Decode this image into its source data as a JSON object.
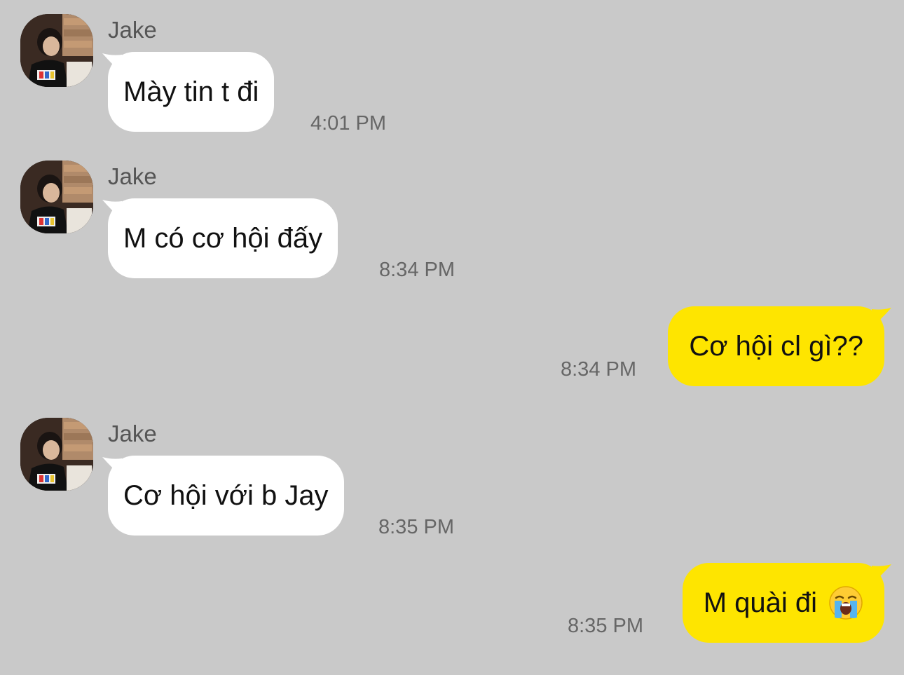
{
  "messages": [
    {
      "direction": "in",
      "sender": "Jake",
      "text": "Mày tin t đi",
      "time": "4:01 PM"
    },
    {
      "direction": "in",
      "sender": "Jake",
      "text": "M có cơ hội đấy",
      "time": "8:34 PM"
    },
    {
      "direction": "out",
      "text": "Cơ hội cl gì??",
      "time": "8:34 PM"
    },
    {
      "direction": "in",
      "sender": "Jake",
      "text": "Cơ hội với b Jay",
      "time": "8:35 PM"
    },
    {
      "direction": "out",
      "text": "M quài đi",
      "emoji": "loudly-crying-face-emoji",
      "time": "8:35 PM"
    }
  ],
  "colors": {
    "background": "#c9c9c9",
    "incoming_bubble": "#ffffff",
    "outgoing_bubble": "#fee500",
    "timestamp": "#666666",
    "sender_name": "#555555"
  }
}
